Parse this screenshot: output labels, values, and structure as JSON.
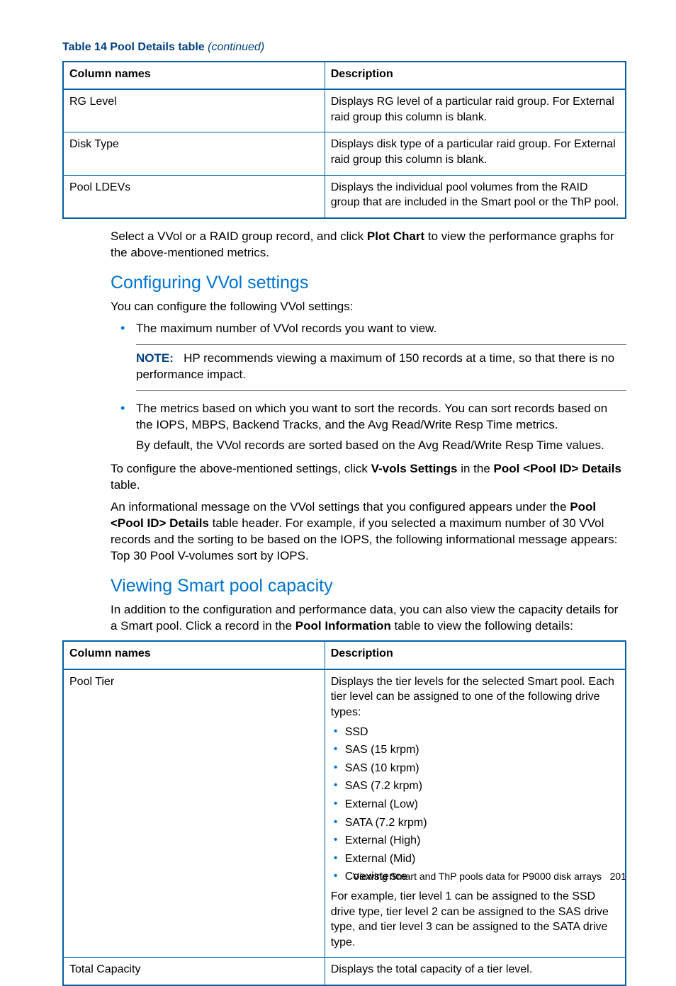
{
  "tableCaption": {
    "prefix": "Table 14 Pool Details table ",
    "cont": "(continued)"
  },
  "table1": {
    "headers": [
      "Column names",
      "Description"
    ],
    "rows": [
      {
        "name": "RG Level",
        "desc": "Displays RG level of a particular raid group. For External raid group this column is blank."
      },
      {
        "name": "Disk Type",
        "desc": "Displays disk type of a particular raid group. For External raid group this column is blank."
      },
      {
        "name": "Pool LDEVs",
        "desc": "Displays the individual pool volumes from the RAID group that are included in the Smart pool or the ThP pool."
      }
    ]
  },
  "para1": {
    "a": "Select a VVol or a RAID group record, and click ",
    "b": "Plot Chart",
    "c": " to view the performance graphs for the above-mentioned metrics."
  },
  "sec1": "Configuring VVol settings",
  "sec1Intro": "You can configure the following VVol settings:",
  "bullets1": {
    "li1": "The maximum number of VVol records you want to view.",
    "note": {
      "label": "NOTE:",
      "text": "HP recommends viewing a maximum of 150 records at a time, so that there is no performance impact."
    },
    "li2a": "The metrics based on which you want to sort the records. You can sort records based on the IOPS, MBPS, Backend Tracks, and the Avg Read/Write Resp Time metrics.",
    "li2b": "By default, the VVol records are sorted based on the Avg Read/Write Resp Time values."
  },
  "para2": {
    "a": "To configure the above-mentioned settings, click ",
    "b": "V-vols Settings",
    "c": " in the ",
    "d": "Pool <Pool ID> Details",
    "e": " table."
  },
  "para3": {
    "a": "An informational message on the VVol settings that you configured appears under the ",
    "b": "Pool <Pool ID> Details",
    "c": " table header. For example, if you selected a maximum number of 30 VVol records and the sorting to be based on the IOPS, the following informational message appears: Top 30 Pool V-volumes sort by IOPS."
  },
  "sec2": "Viewing Smart pool capacity",
  "sec2Para": {
    "a": "In addition to the configuration and performance data, you can also view the capacity details for a Smart pool. Click a record in the ",
    "b": "Pool Information",
    "c": " table to view the following details:"
  },
  "table2": {
    "headers": [
      "Column names",
      "Description"
    ],
    "row1": {
      "name": "Pool Tier",
      "intro": "Displays the tier levels for the selected Smart pool. Each tier level can be assigned to one of the following drive types:",
      "items": [
        "SSD",
        "SAS (15 krpm)",
        "SAS (10 krpm)",
        "SAS (7.2 krpm)",
        "External (Low)",
        "SATA (7.2 krpm)",
        "External (High)",
        "External (Mid)",
        "Coexistence"
      ],
      "outro": "For example, tier level 1 can be assigned to the SSD drive type, tier level 2 can be assigned to the SAS drive type, and tier level 3 can be assigned to the SATA drive type."
    },
    "row2": {
      "name": "Total Capacity",
      "desc": "Displays the total capacity of a tier level."
    }
  },
  "footer": {
    "text": "Viewing Smart and ThP pools data for P9000 disk arrays",
    "page": "201"
  }
}
